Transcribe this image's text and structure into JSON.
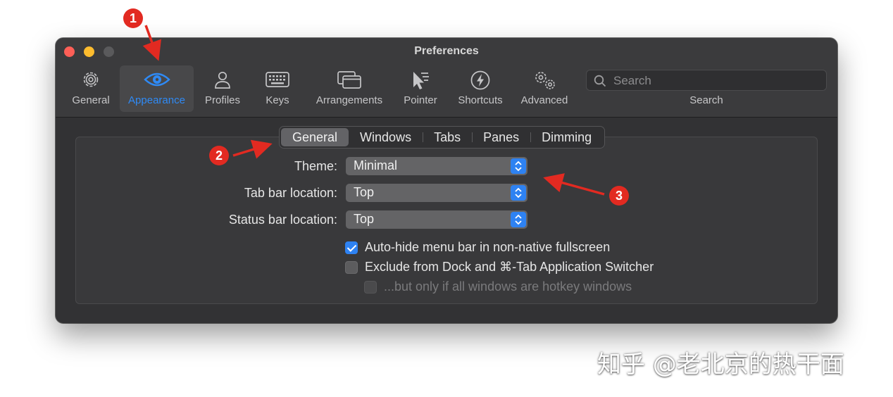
{
  "window": {
    "title": "Preferences",
    "traffic_lights": [
      "close",
      "minimize",
      "zoom"
    ]
  },
  "toolbar": {
    "items": [
      {
        "label": "General",
        "icon": "gear-icon"
      },
      {
        "label": "Appearance",
        "icon": "eye-icon",
        "selected": true
      },
      {
        "label": "Profiles",
        "icon": "person-icon"
      },
      {
        "label": "Keys",
        "icon": "keyboard-icon"
      },
      {
        "label": "Arrangements",
        "icon": "windows-icon"
      },
      {
        "label": "Pointer",
        "icon": "pointer-icon"
      },
      {
        "label": "Shortcuts",
        "icon": "lightning-icon"
      },
      {
        "label": "Advanced",
        "icon": "gears-icon"
      }
    ],
    "search": {
      "placeholder": "Search",
      "label": "Search"
    }
  },
  "tabs": {
    "items": [
      "General",
      "Windows",
      "Tabs",
      "Panes",
      "Dimming"
    ],
    "selected": "General"
  },
  "settings": {
    "theme": {
      "label": "Theme:",
      "value": "Minimal"
    },
    "tab_bar_location": {
      "label": "Tab bar location:",
      "value": "Top"
    },
    "status_bar_location": {
      "label": "Status bar location:",
      "value": "Top"
    },
    "auto_hide_menu_bar": {
      "label": "Auto-hide menu bar in non-native fullscreen",
      "checked": true
    },
    "exclude_from_dock": {
      "label": "Exclude from Dock and ⌘-Tab Application Switcher",
      "checked": false
    },
    "hotkey_windows_only": {
      "label": "...but only if all windows are hotkey windows",
      "checked": false,
      "disabled": true
    }
  },
  "annotations": {
    "badge_1": "1",
    "badge_2": "2",
    "badge_3": "3"
  },
  "watermark": "知乎 @老北京的热干面",
  "colors": {
    "accent": "#2f8af5",
    "annotation_red": "#e22a21",
    "window_bg": "#323234"
  }
}
